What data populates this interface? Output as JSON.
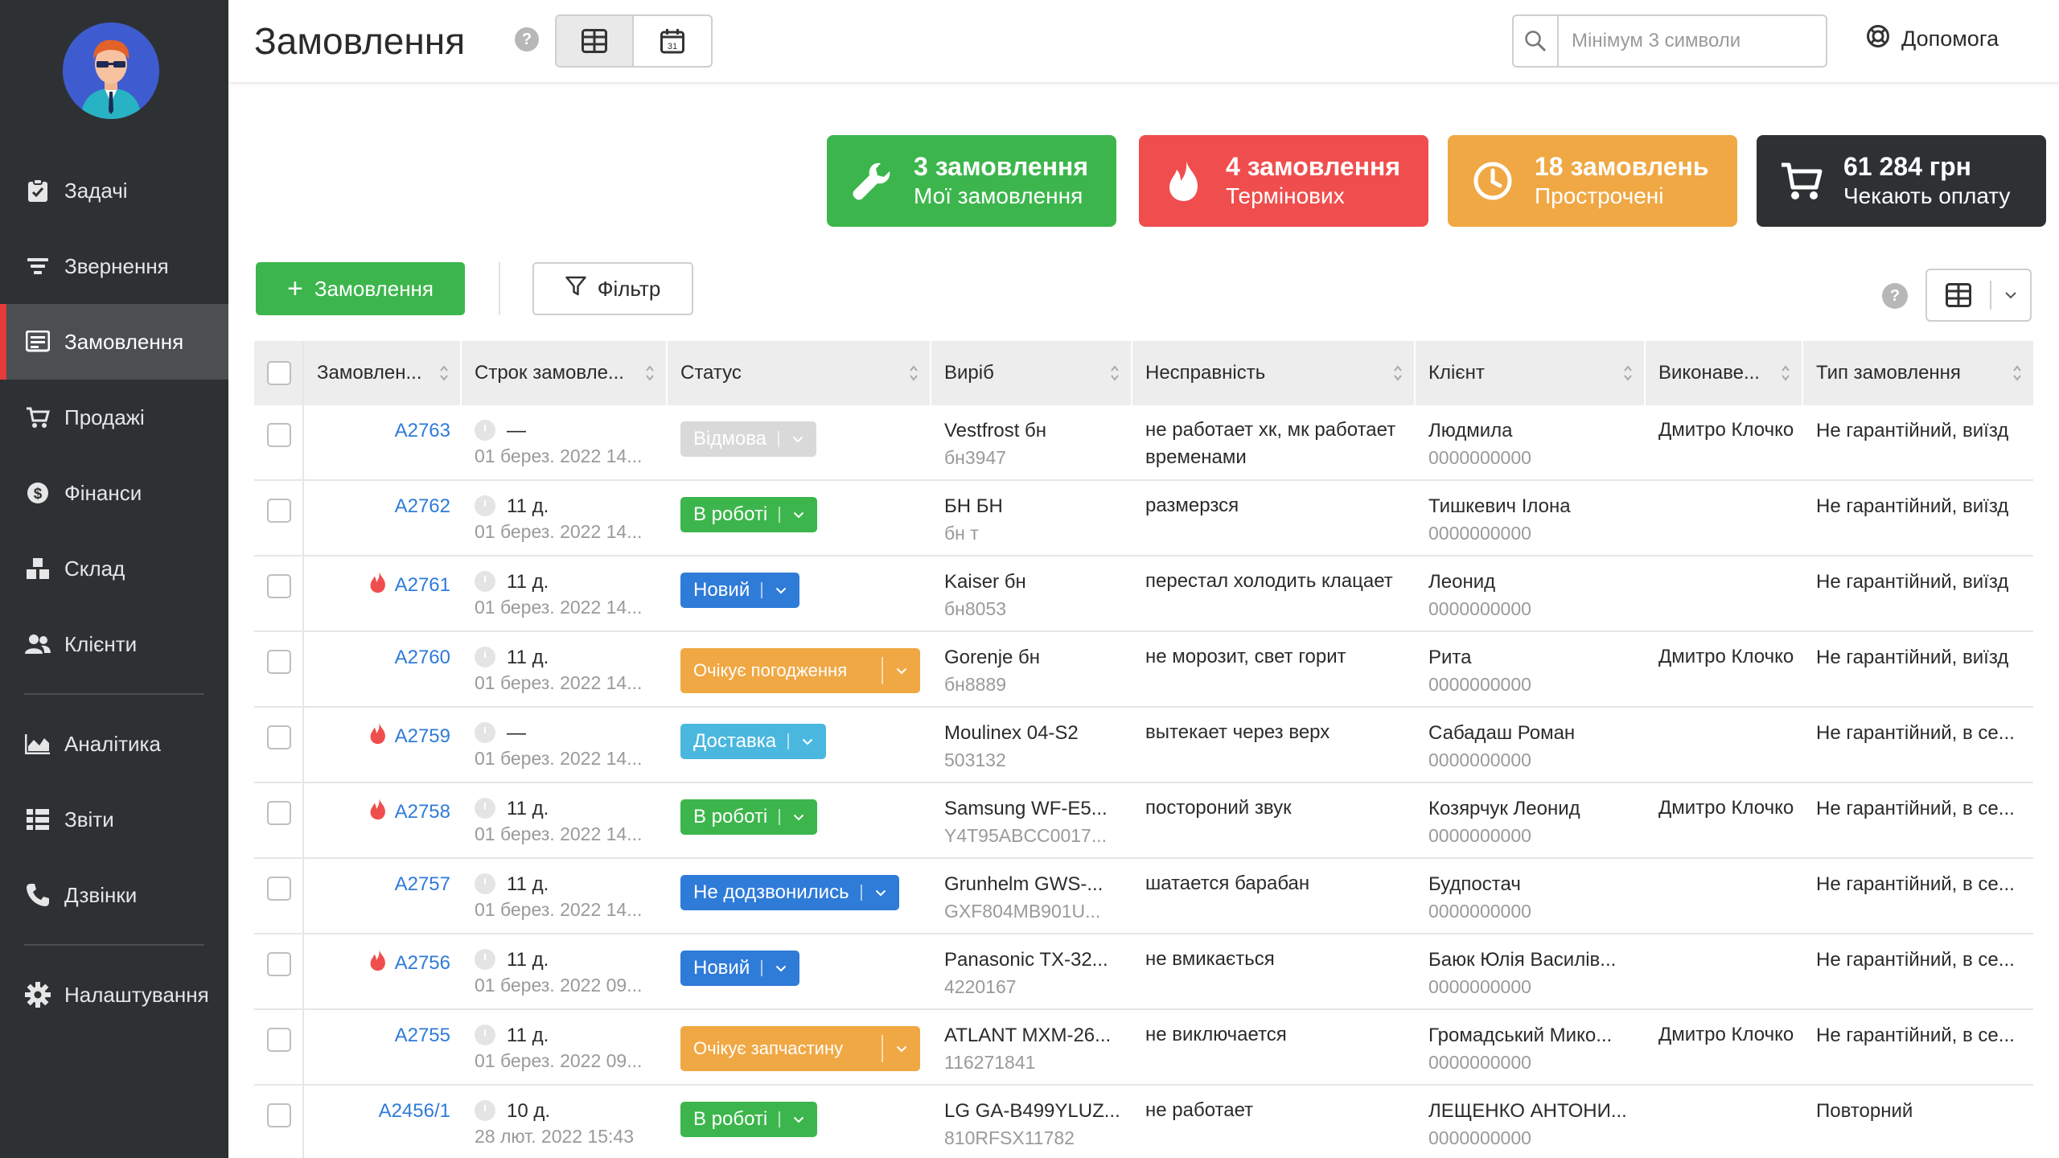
{
  "sidebar": {
    "items": [
      {
        "label": "Задачі",
        "icon": "clipboard-icon"
      },
      {
        "label": "Звернення",
        "icon": "filter-list-icon"
      },
      {
        "label": "Замовлення",
        "icon": "orders-icon"
      },
      {
        "label": "Продажі",
        "icon": "cart-icon"
      },
      {
        "label": "Фінанси",
        "icon": "dollar-icon"
      },
      {
        "label": "Склад",
        "icon": "boxes-icon"
      },
      {
        "label": "Клієнти",
        "icon": "users-icon"
      },
      {
        "label": "Аналітика",
        "icon": "chart-area-icon"
      },
      {
        "label": "Звіти",
        "icon": "reports-icon"
      },
      {
        "label": "Дзвінки",
        "icon": "phone-icon"
      },
      {
        "label": "Налаштування",
        "icon": "gear-icon"
      }
    ],
    "active_index": 2,
    "accent_color": "#e53b3b"
  },
  "header": {
    "title": "Замовлення",
    "help_mark": "?",
    "search_placeholder": "Мінімум 3 символи",
    "help_label": "Допомога"
  },
  "cards": [
    {
      "title": "3 замовлення",
      "subtitle": "Мої замовлення",
      "color": "#3cb64c",
      "icon": "wrench-icon"
    },
    {
      "title": "4 замовлення",
      "subtitle": "Термінових",
      "color": "#f04e4e",
      "icon": "fire-icon"
    },
    {
      "title": "18 замовлень",
      "subtitle": "Прострочені",
      "color": "#f0a844",
      "icon": "clock-icon"
    },
    {
      "title": "61 284 грн",
      "subtitle": "Чекають оплату",
      "color": "#2e3133",
      "icon": "cart-icon"
    }
  ],
  "toolbar": {
    "add_label": "Замовлення",
    "add_plus": "+",
    "filter_label": "Фільтр",
    "help_mark": "?"
  },
  "table": {
    "headers": [
      "Замовлен...",
      "Строк замовле...",
      "Статус",
      "Виріб",
      "Несправність",
      "Клієнт",
      "Виконаве...",
      "Тип замовлення"
    ],
    "rows": [
      {
        "num": "A2763",
        "urgent": false,
        "term": "—",
        "date": "01 берез. 2022 14...",
        "status": "Відмова",
        "status_color": "#d9d9d9",
        "item": "Vestfrost бн",
        "item_sub": "бн3947",
        "issue": "не работает хк, мк работает временами",
        "client": "Людмила",
        "phone": "0000000000",
        "exec": "Дмитро Клочко",
        "type": "Не гарантійний, виїзд"
      },
      {
        "num": "A2762",
        "urgent": false,
        "term": "11 д.",
        "date": "01 берез. 2022 14...",
        "status": "В роботі",
        "status_color": "#3cb64c",
        "item": "БН БН",
        "item_sub": "бн т",
        "issue": "размерзся",
        "client": "Тишкевич Ілона",
        "phone": "0000000000",
        "exec": "",
        "type": "Не гарантійний, виїзд"
      },
      {
        "num": "A2761",
        "urgent": true,
        "term": "11 д.",
        "date": "01 берез. 2022 14...",
        "status": "Новий",
        "status_color": "#2f7bd8",
        "item": "Kaiser бн",
        "item_sub": "бн8053",
        "issue": "перестал холодить клацает",
        "client": "Леонид",
        "phone": "0000000000",
        "exec": "",
        "type": "Не гарантійний, виїзд"
      },
      {
        "num": "A2760",
        "urgent": false,
        "term": "11 д.",
        "date": "01 берез. 2022 14...",
        "status": "Очікує погодження",
        "status_color": "#f0a844",
        "item": "Gorenje бн",
        "item_sub": "бн8889",
        "issue": "не морозит, свет горит",
        "client": "Рита",
        "phone": "0000000000",
        "exec": "Дмитро Клочко",
        "type": "Не гарантійний, виїзд"
      },
      {
        "num": "A2759",
        "urgent": true,
        "term": "—",
        "date": "01 берез. 2022 14...",
        "status": "Доставка",
        "status_color": "#4ab7df",
        "item": "Moulinex 04-S2",
        "item_sub": "503132",
        "issue": "вытекает через верх",
        "client": "Сабадаш Роман",
        "phone": "0000000000",
        "exec": "",
        "type": "Не гарантійний, в се..."
      },
      {
        "num": "A2758",
        "urgent": true,
        "term": "11 д.",
        "date": "01 берез. 2022 14...",
        "status": "В роботі",
        "status_color": "#3cb64c",
        "item": "Samsung WF-E5...",
        "item_sub": "Y4T95ABCC0017...",
        "issue": "постороний звук",
        "client": "Козярчук Леонид",
        "phone": "0000000000",
        "exec": "Дмитро Клочко",
        "type": "Не гарантійний, в се..."
      },
      {
        "num": "A2757",
        "urgent": false,
        "term": "11 д.",
        "date": "01 берез. 2022 14...",
        "status": "Не додзвонились",
        "status_color": "#2f7bd8",
        "item": "Grunhelm GWS-...",
        "item_sub": "GXF804MB901U...",
        "issue": "шатается барабан",
        "client": "Будпостач",
        "phone": "0000000000",
        "exec": "",
        "type": "Не гарантійний, в се..."
      },
      {
        "num": "A2756",
        "urgent": true,
        "term": "11 д.",
        "date": "01 берез. 2022 09...",
        "status": "Новий",
        "status_color": "#2f7bd8",
        "item": "Panasonic TX-32...",
        "item_sub": "4220167",
        "issue": "не вмикається",
        "client": "Баюк Юлія Василів...",
        "phone": "0000000000",
        "exec": "",
        "type": "Не гарантійний, в се..."
      },
      {
        "num": "A2755",
        "urgent": false,
        "term": "11 д.",
        "date": "01 берез. 2022 09...",
        "status": "Очікує запчастину",
        "status_color": "#f0a844",
        "item": "ATLANT MXM-26...",
        "item_sub": "116271841",
        "issue": "не виключается",
        "client": "Громадський Мико...",
        "phone": "0000000000",
        "exec": "Дмитро Клочко",
        "type": "Не гарантійний, в се..."
      },
      {
        "num": "A2456/1",
        "urgent": false,
        "term": "10 д.",
        "date": "28 лют. 2022 15:43",
        "status": "В роботі",
        "status_color": "#3cb64c",
        "item": "LG GA-B499YLUZ...",
        "item_sub": "810RFSX11782",
        "issue": "не работает",
        "client": "ЛЕЩЕНКО АНТОНИ...",
        "phone": "0000000000",
        "exec": "",
        "type": "Повторний"
      }
    ]
  }
}
